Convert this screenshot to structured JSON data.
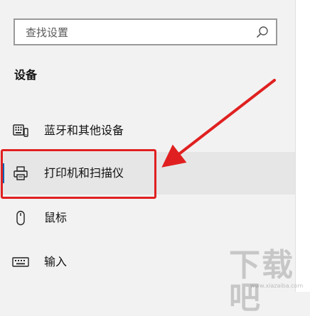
{
  "search": {
    "placeholder": "查找设置"
  },
  "section": {
    "heading": "设备"
  },
  "nav": {
    "items": [
      {
        "label": "蓝牙和其他设备",
        "icon": "keyboard-device-icon",
        "selected": false
      },
      {
        "label": "打印机和扫描仪",
        "icon": "printer-icon",
        "selected": true
      },
      {
        "label": "鼠标",
        "icon": "mouse-icon",
        "selected": false
      },
      {
        "label": "输入",
        "icon": "keyboard-icon",
        "selected": false
      }
    ]
  },
  "annotation": {
    "highlight_color": "#e02020",
    "accent_color": "#0063b1"
  },
  "watermark": {
    "text": "下载吧",
    "url": "www.xiazaiba.com"
  }
}
